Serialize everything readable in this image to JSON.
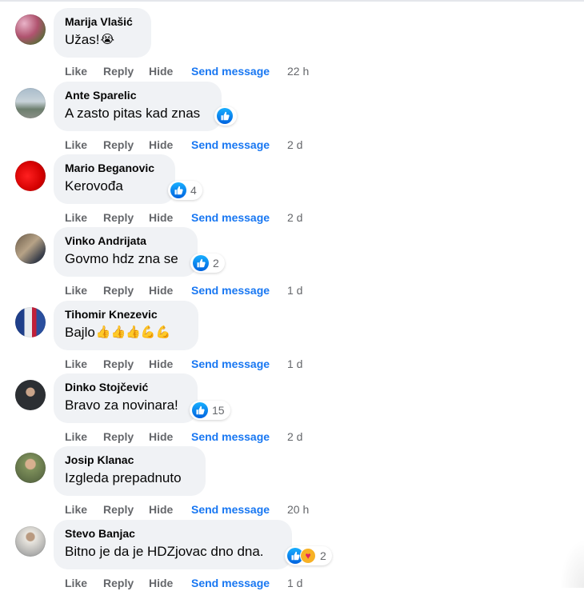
{
  "actions": {
    "like": "Like",
    "reply": "Reply",
    "hide": "Hide",
    "send": "Send message"
  },
  "comments": [
    {
      "author": "Marija Vlašić",
      "text": "Užas!",
      "emoji": "😭",
      "reaction_count": "",
      "time": "22 h"
    },
    {
      "author": "Ante Sparelic",
      "text": "A zasto pitas kad znas",
      "emoji": "",
      "reaction_count": "",
      "time": "2 d"
    },
    {
      "author": "Mario Beganovic",
      "text": "Kerovođa",
      "emoji": "",
      "reaction_count": "4",
      "time": "2 d"
    },
    {
      "author": "Vinko Andrijata",
      "text": "Govmo hdz zna se",
      "emoji": "",
      "reaction_count": "2",
      "time": "1 d"
    },
    {
      "author": "Tihomir Knezevic",
      "text": "Bajlo",
      "emoji": "👍👍👍💪💪",
      "reaction_count": "",
      "time": "1 d"
    },
    {
      "author": "Dinko Stojčević",
      "text": "Bravo za novinara!",
      "emoji": "",
      "reaction_count": "15",
      "time": "2 d"
    },
    {
      "author": "Josip Klanac",
      "text": "Izgleda prepadnuto",
      "emoji": "",
      "reaction_count": "",
      "time": "20 h"
    },
    {
      "author": "Stevo Banjac",
      "text": "Bitno je da je HDZjovac dno dna.",
      "emoji": "",
      "reaction_count": "2",
      "time": "1 d"
    }
  ],
  "colors": {
    "bubble": "#f0f2f5",
    "accent_link": "#1877f2",
    "muted_text": "#65676b",
    "like_reaction": "#1877f2"
  }
}
